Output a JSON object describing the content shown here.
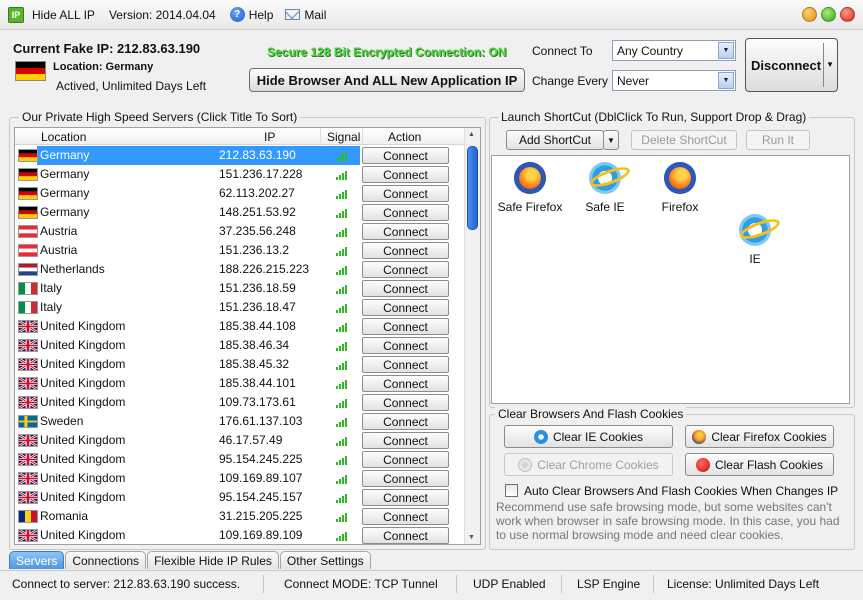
{
  "window": {
    "title": "Hide ALL IP",
    "version": "Version: 2014.04.04",
    "help": "Help",
    "mail": "Mail",
    "icon_text": "IP"
  },
  "header": {
    "current_ip": "Current Fake IP: 212.83.63.190",
    "location": "Location: Germany",
    "active": "Actived, Unlimited Days Left",
    "secure": "Secure 128 Bit Encrypted Connection: ON",
    "hide_button": "Hide Browser And ALL New Application IP",
    "connect_to_label": "Connect To",
    "connect_to_value": "Any Country",
    "change_every_label": "Change Every",
    "change_every_value": "Never",
    "disconnect": "Disconnect"
  },
  "servers": {
    "group_title": "Our Private High Speed Servers (Click Title To Sort)",
    "columns": {
      "location": "Location",
      "ip": "IP",
      "signal": "Signal",
      "action": "Action"
    },
    "rows": [
      {
        "location": "Germany",
        "ip": "212.83.63.190",
        "flag": "de",
        "action": "Connect"
      },
      {
        "location": "Germany",
        "ip": "151.236.17.228",
        "flag": "de",
        "action": "Connect"
      },
      {
        "location": "Germany",
        "ip": "62.113.202.27",
        "flag": "de",
        "action": "Connect"
      },
      {
        "location": "Germany",
        "ip": "148.251.53.92",
        "flag": "de",
        "action": "Connect"
      },
      {
        "location": "Austria",
        "ip": "37.235.56.248",
        "flag": "at",
        "action": "Connect"
      },
      {
        "location": "Austria",
        "ip": "151.236.13.2",
        "flag": "at",
        "action": "Connect"
      },
      {
        "location": "Netherlands",
        "ip": "188.226.215.223",
        "flag": "nl",
        "action": "Connect"
      },
      {
        "location": "Italy",
        "ip": "151.236.18.59",
        "flag": "it",
        "action": "Connect"
      },
      {
        "location": "Italy",
        "ip": "151.236.18.47",
        "flag": "it",
        "action": "Connect"
      },
      {
        "location": "United Kingdom",
        "ip": "185.38.44.108",
        "flag": "uk",
        "action": "Connect"
      },
      {
        "location": "United Kingdom",
        "ip": "185.38.46.34",
        "flag": "uk",
        "action": "Connect"
      },
      {
        "location": "United Kingdom",
        "ip": "185.38.45.32",
        "flag": "uk",
        "action": "Connect"
      },
      {
        "location": "United Kingdom",
        "ip": "185.38.44.101",
        "flag": "uk",
        "action": "Connect"
      },
      {
        "location": "United Kingdom",
        "ip": "109.73.173.61",
        "flag": "uk",
        "action": "Connect"
      },
      {
        "location": "Sweden",
        "ip": "176.61.137.103",
        "flag": "se",
        "action": "Connect"
      },
      {
        "location": "United Kingdom",
        "ip": "46.17.57.49",
        "flag": "uk",
        "action": "Connect"
      },
      {
        "location": "United Kingdom",
        "ip": "95.154.245.225",
        "flag": "uk",
        "action": "Connect"
      },
      {
        "location": "United Kingdom",
        "ip": "109.169.89.107",
        "flag": "uk",
        "action": "Connect"
      },
      {
        "location": "United Kingdom",
        "ip": "95.154.245.157",
        "flag": "uk",
        "action": "Connect"
      },
      {
        "location": "Romania",
        "ip": "31.215.205.225",
        "flag": "ro",
        "action": "Connect"
      },
      {
        "location": "United Kingdom",
        "ip": "109.169.89.109",
        "flag": "uk",
        "action": "Connect"
      }
    ]
  },
  "shortcuts": {
    "group_title": "Launch ShortCut (DblClick To Run, Support Drop & Drag)",
    "add": "Add ShortCut",
    "delete": "Delete ShortCut",
    "run": "Run It",
    "items": [
      {
        "label": "Safe Firefox",
        "icon": "firefox-icon"
      },
      {
        "label": "Safe IE",
        "icon": "ie-icon"
      },
      {
        "label": "Firefox",
        "icon": "firefox-icon"
      },
      {
        "label": "IE",
        "icon": "ie-icon"
      }
    ]
  },
  "cookies": {
    "group_title": "Clear Browsers And Flash Cookies",
    "clear_ie": "Clear IE Cookies",
    "clear_firefox": "Clear Firefox Cookies",
    "clear_chrome": "Clear Chrome Cookies",
    "clear_flash": "Clear Flash Cookies",
    "auto_clear": "Auto Clear Browsers And Flash Cookies When Changes IP",
    "note": "Recommend use safe browsing mode, but some websites can't work when browser in safe browsing mode. In this case, you had to use normal browsing mode and need clear cookies."
  },
  "tabs": [
    "Servers",
    "Connections",
    "Flexible Hide IP Rules",
    "Other Settings"
  ],
  "status": {
    "server": "Connect to server: 212.83.63.190 success.",
    "mode": "Connect MODE: TCP Tunnel",
    "udp": "UDP Enabled",
    "lsp": "LSP Engine",
    "license": "License: Unlimited Days Left"
  },
  "colors": {
    "secure_text": "#3cdc33",
    "selection": "#3399ff",
    "active_tab": "#4f97e0"
  }
}
